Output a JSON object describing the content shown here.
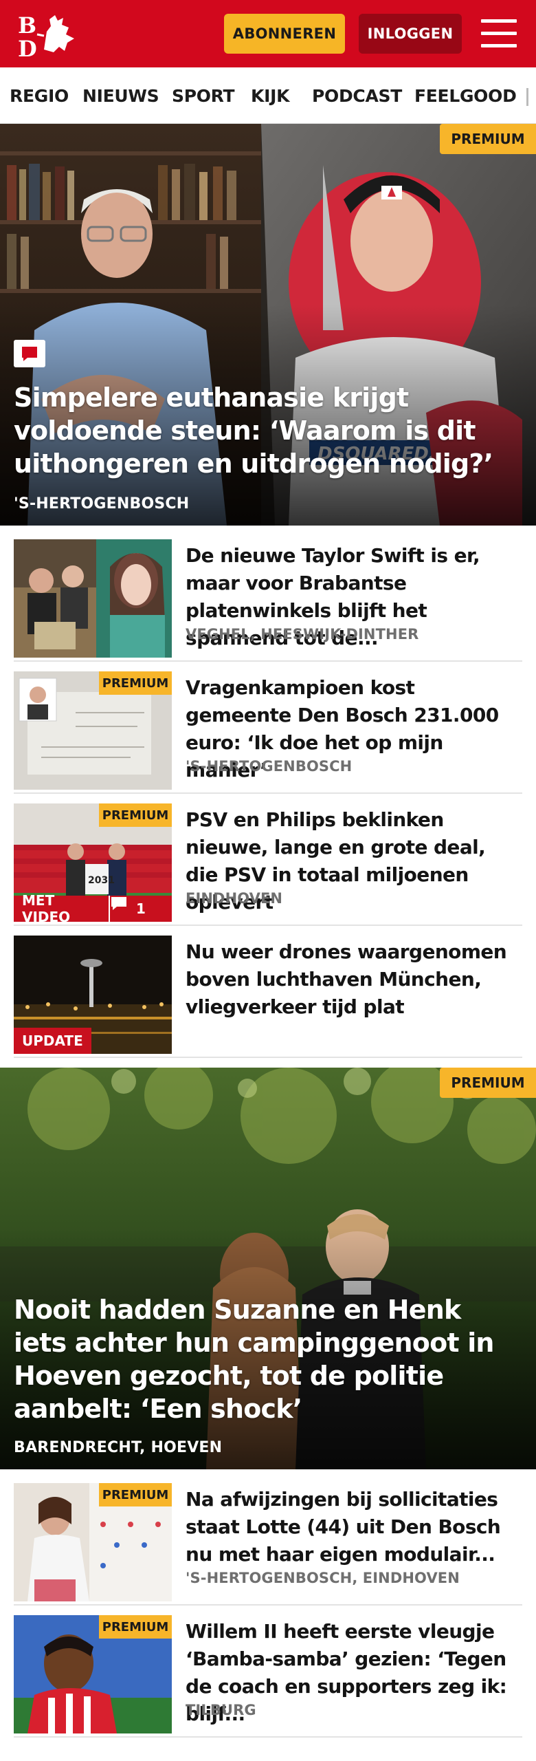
{
  "header": {
    "subscribe_label": "ABONNEREN",
    "login_label": "INLOGGEN",
    "brand_color": "#d2081d",
    "subscribe_color": "#f6b526"
  },
  "nav": {
    "items": [
      "REGIO",
      "NIEUWS",
      "SPORT",
      "KIJK",
      "PODCAST",
      "FEELGOOD"
    ]
  },
  "hero1": {
    "badge": "PREMIUM",
    "title": "Simpelere euthanasie krijgt voldoende steun: ‘Waarom is dit uithongeren en uitdrogen nodig?’",
    "location": "'S-HERTOGENBOSCH",
    "has_comments_icon": "comment-icon"
  },
  "articles": [
    {
      "title": "De nieuwe Taylor Swift is er, maar voor Brabantse platenwin­kels blijft het spannend tot de...",
      "location": "VEGHEL, HEESWIJK-DINTHER"
    },
    {
      "badge": "PREMIUM",
      "title": "Vragenkampioen kost gemeente Den Bosch 231.000 euro: ‘Ik doe het op mijn manier’",
      "location": "'S-HERTOGENBOSCH"
    },
    {
      "badge": "PREMIUM",
      "label": "MET VIDEO",
      "comments": "1",
      "title": "PSV en Philips beklinken nieuwe, lange en grote deal, die PSV in totaal miljoenen oplevert",
      "location": "EINDHOVEN"
    },
    {
      "label": "UPDATE",
      "title": "Nu weer drones waargenomen boven luchthaven München, vliegverkeer tijd plat",
      "location": ""
    }
  ],
  "hero2": {
    "badge": "PREMIUM",
    "title": "Nooit hadden Suzanne en Henk iets achter hun campinggenoot in Hoeven gezocht, tot de politie aanbelt: ‘Een shock’",
    "location": "BARENDRECHT, HOEVEN"
  },
  "articles2": [
    {
      "badge": "PREMIUM",
      "title": "Na afwijzingen bij sollicitaties staat Lotte (44) uit Den Bosch nu met haar eigen modulair...",
      "location": "'S-HERTOGENBOSCH, EINDHOVEN"
    },
    {
      "badge": "PREMIUM",
      "title": "Willem II heeft eerste vleugje ‘Bamba-samba’ gezien: ‘Tegen de coach en supporters zeg ik: blijf...",
      "location": "TILBURG"
    }
  ]
}
